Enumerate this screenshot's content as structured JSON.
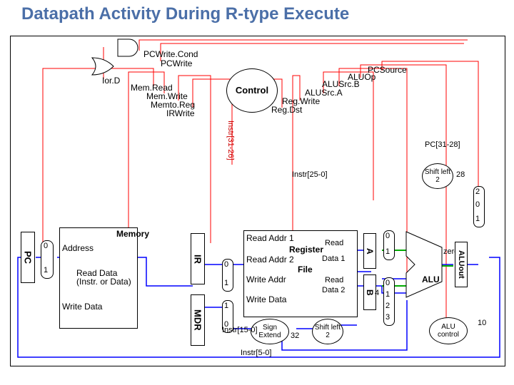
{
  "title": "Datapath Activity During R-type Execute",
  "signals": {
    "pcwritecond": "PCWrite.Cond",
    "pcwrite": "PCWrite",
    "iord": "Ior.D",
    "memread": "Mem.Read",
    "memwrite": "Mem.Write",
    "memtoreg": "Memto.Reg",
    "irwrite": "IRWrite",
    "instr3126": "Instr[31-26]",
    "control": "Control",
    "regdst": "Reg.Dst",
    "regwrite": "Reg.Write",
    "alusrca": "ALUSrc.A",
    "alusrcb": "ALUSrc.B",
    "aluop": "ALUOp",
    "pcsource": "PCSource"
  },
  "blocks": {
    "pc": "PC",
    "memory": "Memory",
    "address": "Address",
    "readdata": "Read Data\n(Instr. or Data)",
    "writedata": "Write Data",
    "ir": "IR",
    "mdr": "MDR",
    "regfile": "Register File",
    "readaddr1": "Read Addr 1",
    "readaddr2": "Read Addr 2",
    "readdata1": "Read Data 1",
    "writeaddr": "Write Addr",
    "writedata2": "Write Data",
    "readdata2": "Read Data 2",
    "a": "A",
    "b": "B",
    "alu": "ALU",
    "zero": "zero",
    "aluout": "ALUout",
    "alucontrol": "ALU control",
    "signextend": "Sign Extend",
    "shiftleft2a": "Shift left 2",
    "shiftleft2b": "Shift left 2",
    "pc3128": "PC[31-28]",
    "instr250": "Instr[25-0]",
    "instr150": "Instr[15-0]",
    "instr50": "Instr[5-0]",
    "n28": "28",
    "n32": "32",
    "n4": "4",
    "n10": "10",
    "m0": "0",
    "m1": "1",
    "m2": "2",
    "m3": "3"
  }
}
